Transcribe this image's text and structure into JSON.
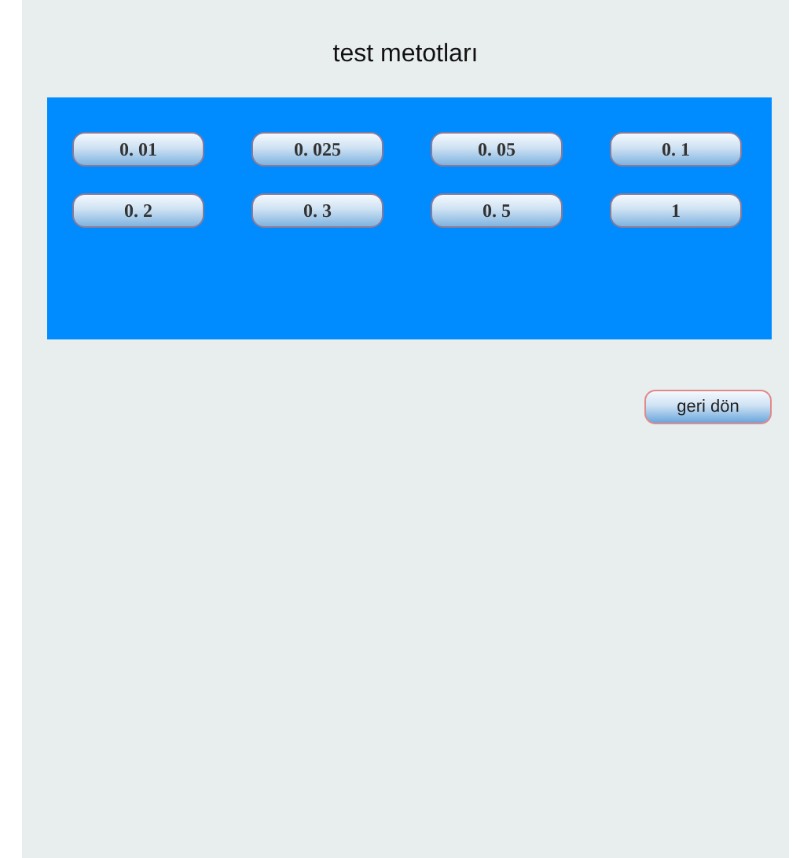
{
  "title": "test metotları",
  "methods": [
    "0. 01",
    "0. 025",
    "0. 05",
    "0. 1",
    "0. 2",
    "0. 3",
    "0. 5",
    "1"
  ],
  "back_button": "geri dön"
}
